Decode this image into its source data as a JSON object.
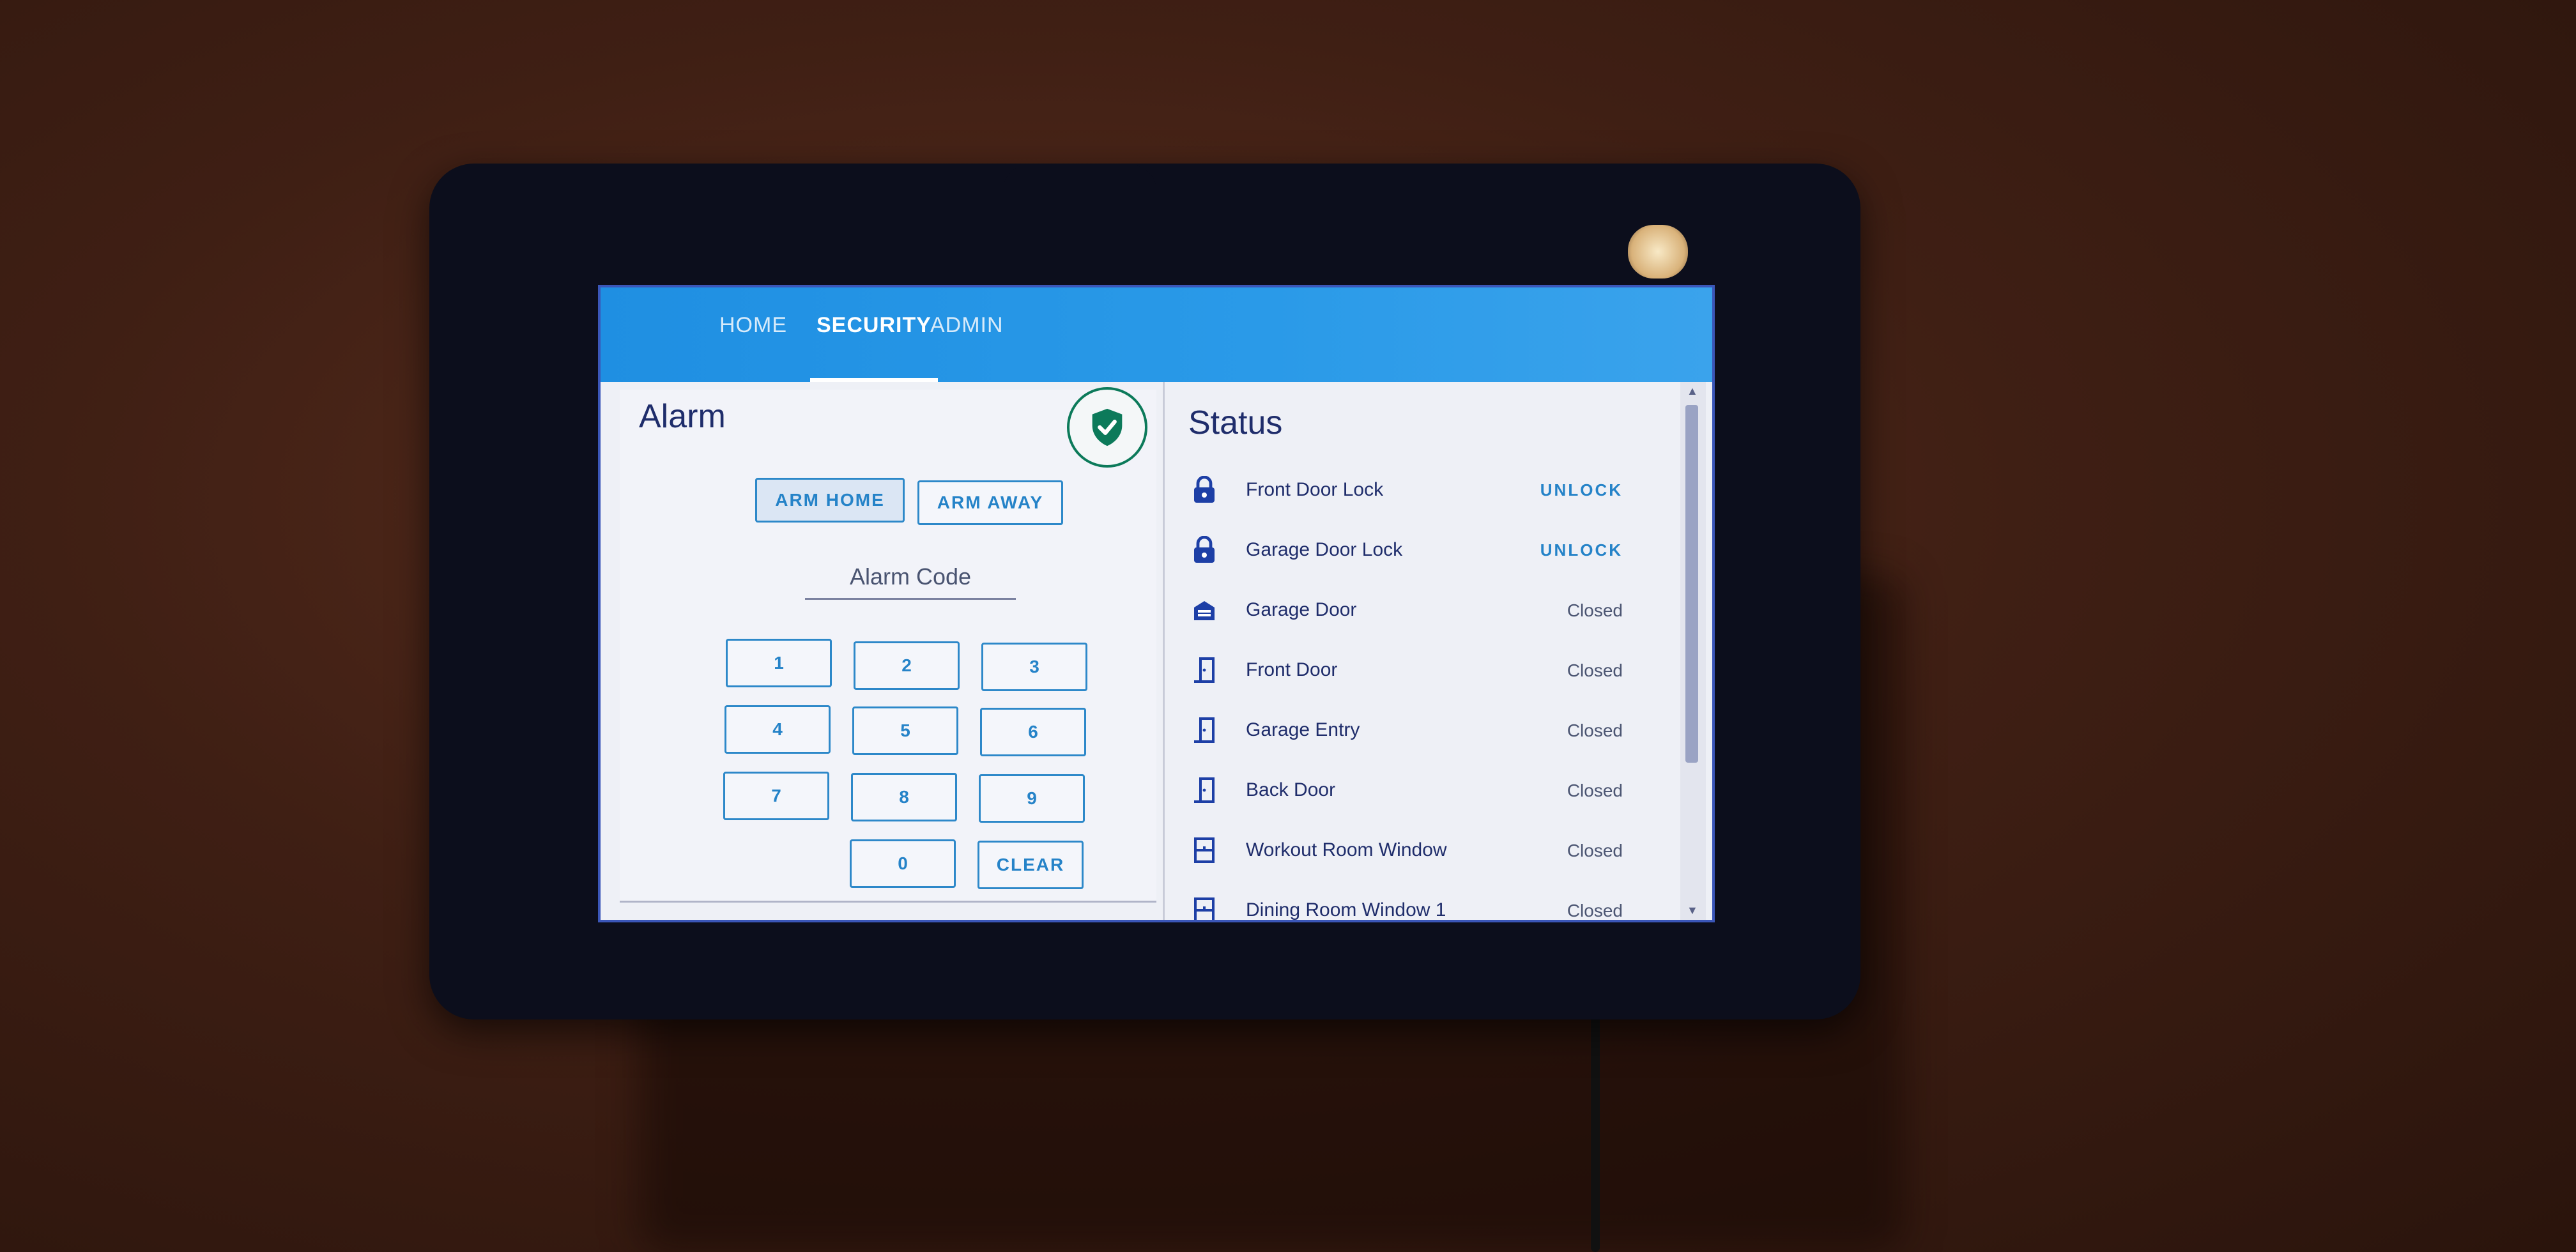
{
  "nav": {
    "tabs": [
      {
        "label": "HOME"
      },
      {
        "label": "SECURITY"
      },
      {
        "label": "ADMIN"
      }
    ],
    "active_tab": "SECURITY"
  },
  "alarm": {
    "title": "Alarm",
    "status_icon": "shield-check-icon",
    "arm_home_label": "ARM HOME",
    "arm_away_label": "ARM AWAY",
    "code_label": "Alarm Code",
    "keypad": [
      "1",
      "2",
      "3",
      "4",
      "5",
      "6",
      "7",
      "8",
      "9",
      "0",
      "CLEAR"
    ]
  },
  "status": {
    "title": "Status",
    "items": [
      {
        "icon": "lock-icon",
        "name": "Front Door Lock",
        "action": "UNLOCK"
      },
      {
        "icon": "lock-icon",
        "name": "Garage Door Lock",
        "action": "UNLOCK"
      },
      {
        "icon": "garage-icon",
        "name": "Garage Door",
        "value": "Closed"
      },
      {
        "icon": "door-icon",
        "name": "Front Door",
        "value": "Closed"
      },
      {
        "icon": "door-icon",
        "name": "Garage Entry",
        "value": "Closed"
      },
      {
        "icon": "door-icon",
        "name": "Back Door",
        "value": "Closed"
      },
      {
        "icon": "window-icon",
        "name": "Workout Room Window",
        "value": "Closed"
      },
      {
        "icon": "window-icon",
        "name": "Dining Room Window 1",
        "value": "Closed"
      }
    ]
  },
  "colors": {
    "topbar": "#1f8fe2",
    "accent": "#2583c8",
    "shield": "#0c7a5a",
    "icon": "#1d3fa6"
  }
}
